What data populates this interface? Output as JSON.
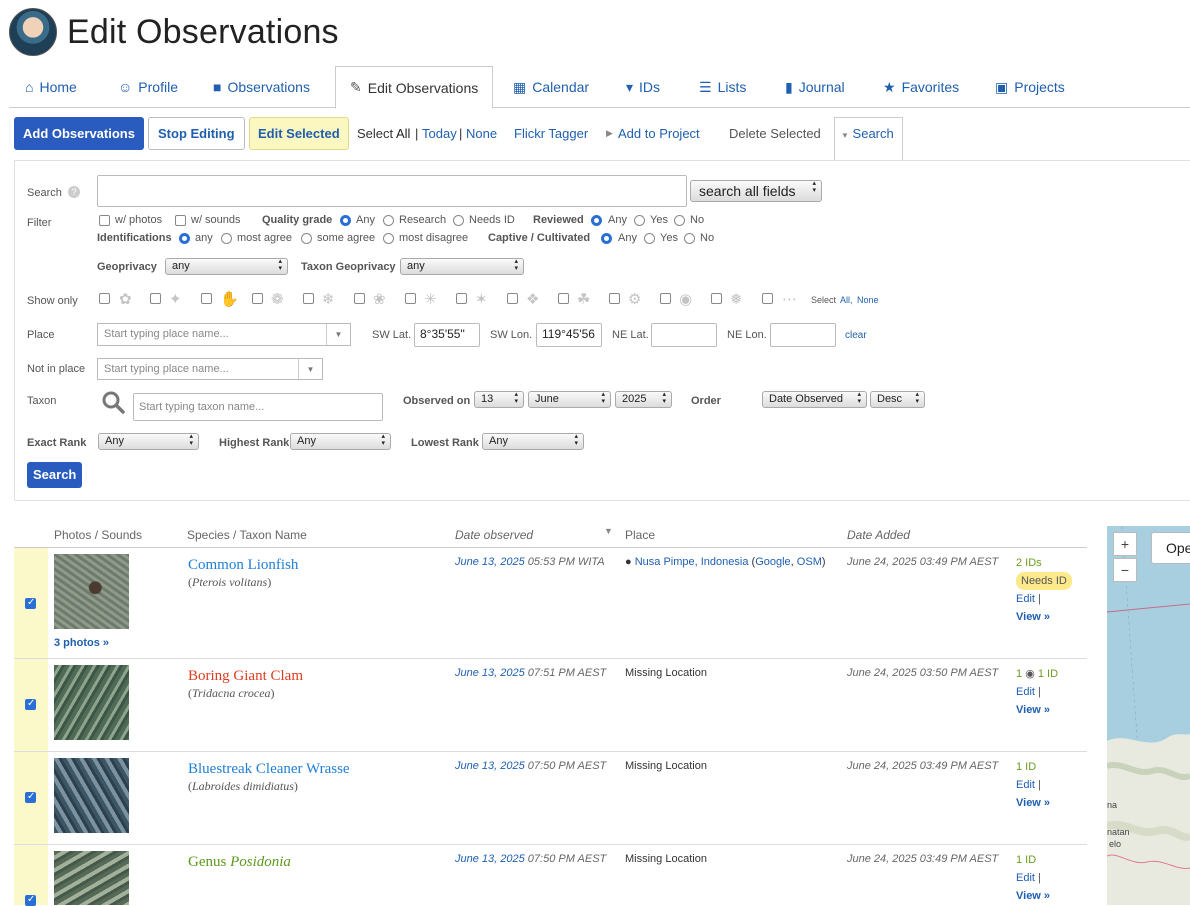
{
  "header": {
    "title": "Edit Observations"
  },
  "nav": [
    {
      "label": "Home",
      "icon": "home-icon",
      "glyph": "⌂"
    },
    {
      "label": "Profile",
      "icon": "user-icon",
      "glyph": "☺"
    },
    {
      "label": "Observations",
      "icon": "binoculars-icon",
      "glyph": "■"
    },
    {
      "label": "Edit Observations",
      "icon": "pencil-icon",
      "glyph": "✎"
    },
    {
      "label": "Calendar",
      "icon": "calendar-icon",
      "glyph": "▦"
    },
    {
      "label": "IDs",
      "icon": "shield-icon",
      "glyph": "▾"
    },
    {
      "label": "Lists",
      "icon": "list-icon",
      "glyph": "☰"
    },
    {
      "label": "Journal",
      "icon": "book-icon",
      "glyph": "▮"
    },
    {
      "label": "Favorites",
      "icon": "star-icon",
      "glyph": "★"
    },
    {
      "label": "Projects",
      "icon": "briefcase-icon",
      "glyph": "▣"
    }
  ],
  "toolbar": {
    "add": "Add Observations",
    "stop": "Stop Editing",
    "edit_selected": "Edit Selected",
    "select_label": "Select",
    "all": "All",
    "sep1": "|",
    "today": "Today",
    "sep2": "|",
    "none": "None",
    "flickr": "Flickr Tagger",
    "add_project": "Add to Project",
    "delete": "Delete Selected",
    "search_tab": "Search"
  },
  "search": {
    "label": "Search",
    "query": "",
    "scope": "search all fields",
    "filter_label": "Filter",
    "w_photos": "w/ photos",
    "w_sounds": "w/ sounds",
    "quality_label": "Quality grade",
    "quality_opts": [
      "Any",
      "Research",
      "Needs ID"
    ],
    "reviewed_label": "Reviewed",
    "reviewed_opts": [
      "Any",
      "Yes",
      "No"
    ],
    "identifications_label": "Identifications",
    "ident_opts": [
      "any",
      "most agree",
      "some agree",
      "most disagree"
    ],
    "captive_label": "Captive / Cultivated",
    "captive_opts": [
      "Any",
      "Yes",
      "No"
    ],
    "geoprivacy_label": "Geoprivacy",
    "geoprivacy": "any",
    "taxon_geoprivacy_label": "Taxon Geoprivacy",
    "taxon_geoprivacy": "any",
    "show_only_label": "Show only",
    "show_only_select": "Select",
    "show_only_all": "All,",
    "show_only_none": "None",
    "place_label": "Place",
    "place_placeholder": "Start typing place name...",
    "sw_lat_label": "SW Lat.",
    "sw_lat": "8°35'55\"",
    "sw_lon_label": "SW Lon.",
    "sw_lon": "119°45'56",
    "ne_lat_label": "NE Lat.",
    "ne_lat": "",
    "ne_lon_label": "NE Lon.",
    "ne_lon": "",
    "clear": "clear",
    "not_in_place_label": "Not in place",
    "not_in_place_placeholder": "Start typing place name...",
    "taxon_label": "Taxon",
    "taxon_placeholder": "Start typing taxon name...",
    "observed_on_label": "Observed on",
    "obs_day": "13",
    "obs_month": "June",
    "obs_year": "2025",
    "order_label": "Order",
    "order_by": "Date Observed",
    "order_dir": "Desc",
    "exact_rank_label": "Exact Rank",
    "exact_rank": "Any",
    "highest_rank_label": "Highest Rank",
    "highest_rank": "Any",
    "lowest_rank_label": "Lowest Rank",
    "lowest_rank": "Any",
    "submit": "Search"
  },
  "table": {
    "headers": [
      "Photos / Sounds",
      "Species / Taxon Name",
      "Date observed",
      "Place",
      "Date Added"
    ],
    "rows": [
      {
        "photos_link": "3 photos »",
        "common": "Common Lionfish",
        "sci": "Pterois volitans",
        "name_color": "#1f7fd6",
        "date": "June 13, 2025",
        "time": "05:53 PM WITA",
        "place_main": "Nusa Pimpe, Indonesia",
        "place_open": "(",
        "place_google": "Google",
        "place_comma": ",",
        "place_osm": "OSM",
        "place_close": ")",
        "added": "June 24, 2025 03:49 PM AEST",
        "ids": "2 IDs",
        "badge": "Needs ID",
        "edit": "Edit",
        "view": "View »"
      },
      {
        "common": "Boring Giant Clam",
        "sci": "Tridacna crocea",
        "name_color": "#e03c1e",
        "date": "June 13, 2025",
        "time": "07:51 PM AEST",
        "place_text": "Missing Location",
        "added": "June 24, 2025 03:50 PM AEST",
        "ids_count": "1",
        "ids_comment": "1 ID",
        "edit": "Edit",
        "view": "View »"
      },
      {
        "common": "Bluestreak Cleaner Wrasse",
        "sci": "Labroides dimidiatus",
        "name_color": "#1f7fd6",
        "date": "June 13, 2025",
        "time": "07:50 PM AEST",
        "place_text": "Missing Location",
        "added": "June 24, 2025 03:49 PM AEST",
        "ids": "1 ID",
        "edit": "Edit",
        "view": "View »"
      },
      {
        "common_prefix": "Genus",
        "common_genus": "Posidonia",
        "name_color": "#5c9a1b",
        "date": "June 13, 2025",
        "time": "07:50 PM AEST",
        "place_text": "Missing Location",
        "added": "June 24, 2025 03:49 PM AEST",
        "ids": "1 ID",
        "edit": "Edit",
        "view": "View »"
      }
    ]
  },
  "map": {
    "zoom_in": "+",
    "zoom_out": "−",
    "open": "Ope",
    "labels": [
      "na",
      "natan",
      "elo"
    ]
  }
}
